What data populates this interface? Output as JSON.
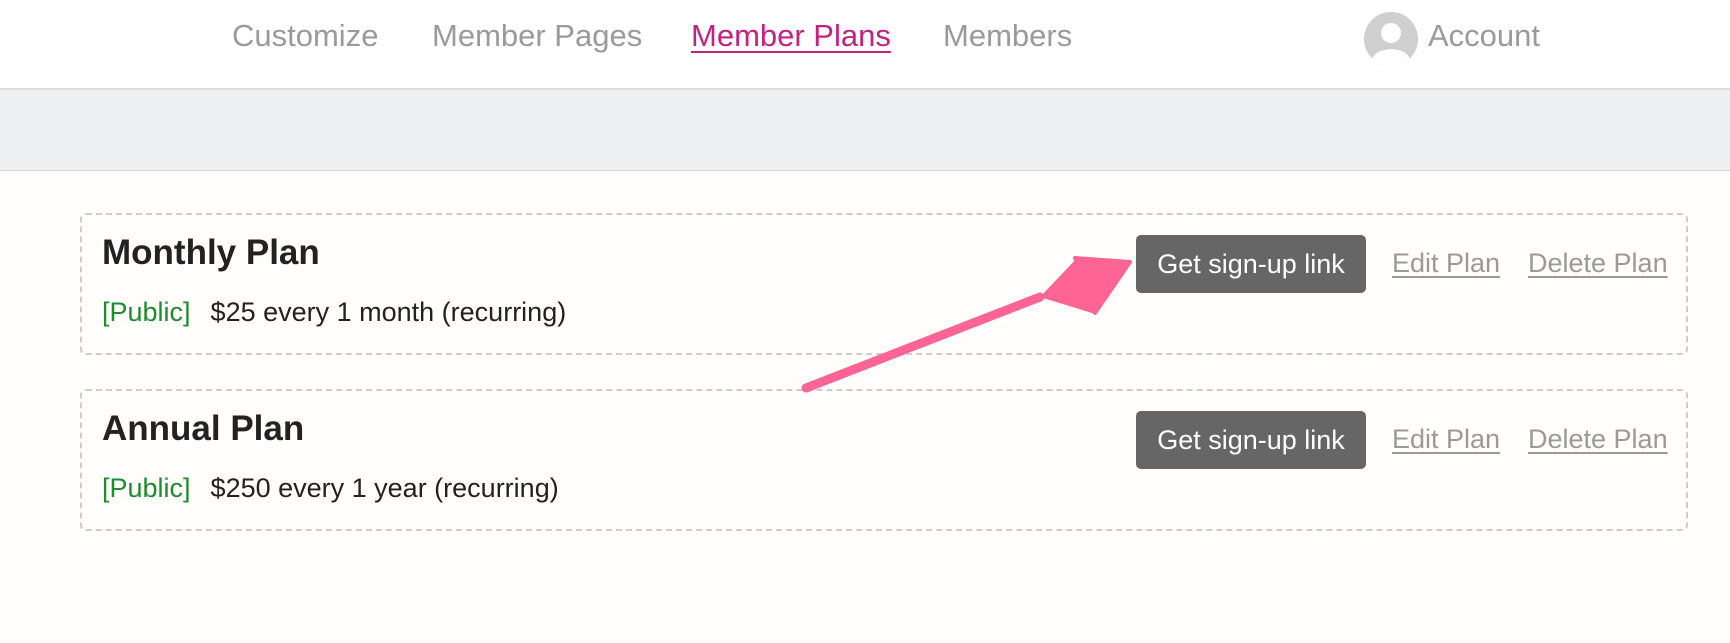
{
  "nav": {
    "items": [
      {
        "label": "Customize",
        "active": false
      },
      {
        "label": "Member Pages",
        "active": false
      },
      {
        "label": "Member Plans",
        "active": true
      },
      {
        "label": "Members",
        "active": false
      }
    ],
    "account_label": "Account",
    "active_color": "#c3237f",
    "inactive_color": "#9a9a9a"
  },
  "plans": [
    {
      "title": "Monthly Plan",
      "visibility": "[Public]",
      "price": "$25 every 1 month (recurring)",
      "signup_label": "Get sign-up link",
      "edit_label": "Edit Plan",
      "delete_label": "Delete Plan"
    },
    {
      "title": "Annual Plan",
      "visibility": "[Public]",
      "price": "$250 every 1 year (recurring)",
      "signup_label": "Get sign-up link",
      "edit_label": "Edit Plan",
      "delete_label": "Delete Plan"
    }
  ],
  "annotation": {
    "arrow_color": "#ff6496"
  },
  "colors": {
    "public_green": "#1f8a2e",
    "button_grey": "#666666",
    "band_grey": "#eeeff0"
  }
}
